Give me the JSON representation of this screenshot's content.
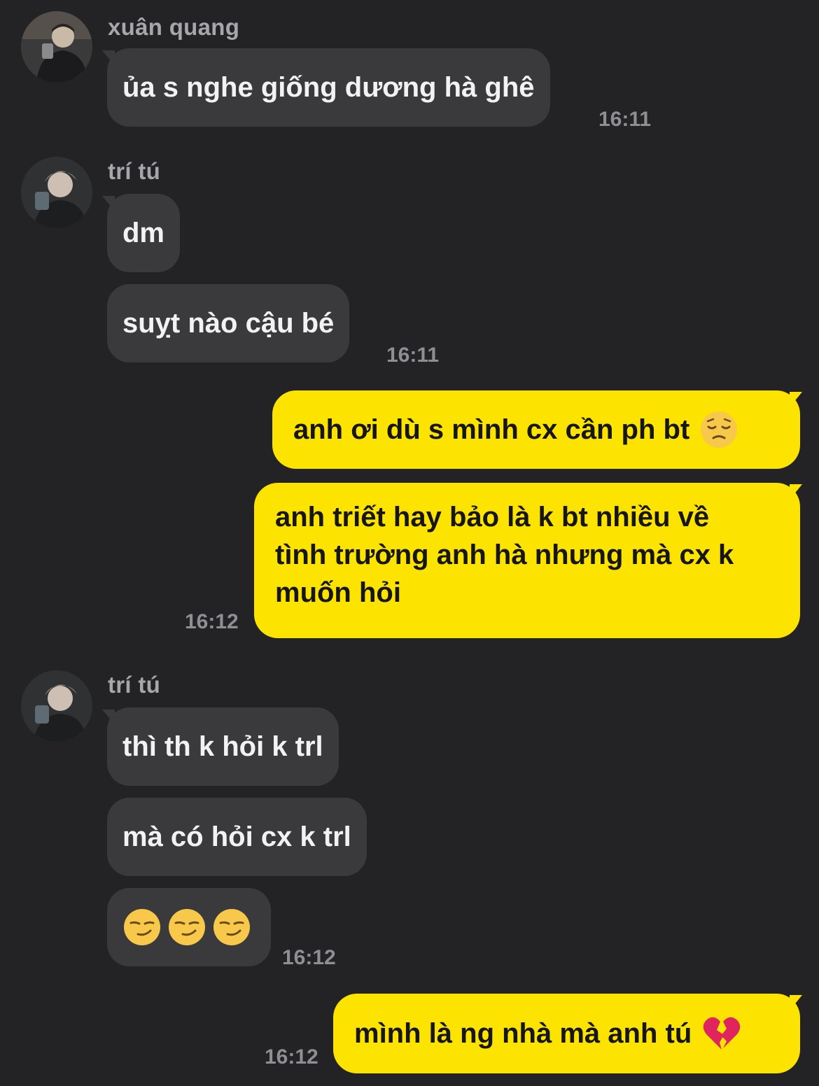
{
  "colors": {
    "background": "#232325",
    "incoming_bubble": "#3a3a3d",
    "outgoing_bubble": "#fde300",
    "timestamp": "#8f8f93",
    "sender_name": "#a7a7ab"
  },
  "messages": [
    {
      "sender": "xuân quang",
      "text": "ủa s nghe giống dương hà ghê",
      "time": "16:11"
    },
    {
      "sender": "trí tú",
      "texts": [
        "dm",
        "suỵt nào cậu bé"
      ],
      "time": "16:11"
    },
    {
      "outgoing": [
        "anh ơi dù s mình cx cần ph bt",
        "anh triết hay bảo là k bt nhiều về",
        "tình trường anh hà nhưng mà cx k",
        "muốn hỏi"
      ],
      "time": "16:12"
    },
    {
      "sender": "trí tú",
      "texts": [
        "thì th k hỏi k trl",
        "mà có hỏi cx k trl"
      ],
      "time": "16:12",
      "emoji_message": [
        "smirking-face",
        "smirking-face",
        "smirking-face"
      ]
    },
    {
      "outgoing_text": "mình là ng nhà mà anh tú",
      "time": "16:12",
      "emoji": "broken-heart"
    }
  ],
  "emoji": {
    "pensive": "pensive-face",
    "broken_heart": "broken-heart"
  }
}
